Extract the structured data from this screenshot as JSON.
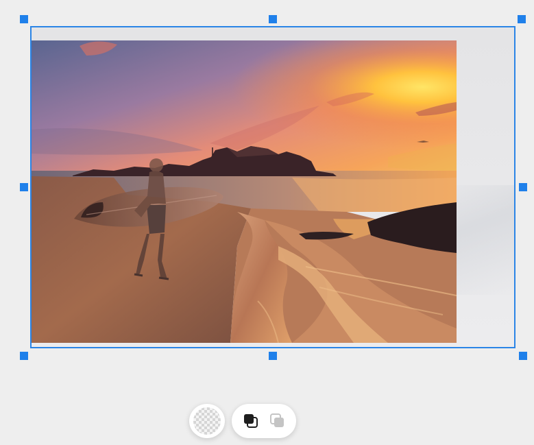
{
  "editor": {
    "canvas_background": "#eeeeee",
    "selection_color": "#2a84e6",
    "selected_layer": {
      "content": "sunset-beach-surfer-photo"
    },
    "handles": [
      "top-left",
      "top-center",
      "top-right",
      "middle-left",
      "middle-right",
      "bottom-left",
      "bottom-center",
      "bottom-right"
    ]
  },
  "toolbar": {
    "transparency_icon": "checkerboard-icon",
    "bring_forward_icon": "bring-forward-icon",
    "send_backward_icon": "send-backward-icon",
    "send_backward_state": "disabled"
  }
}
